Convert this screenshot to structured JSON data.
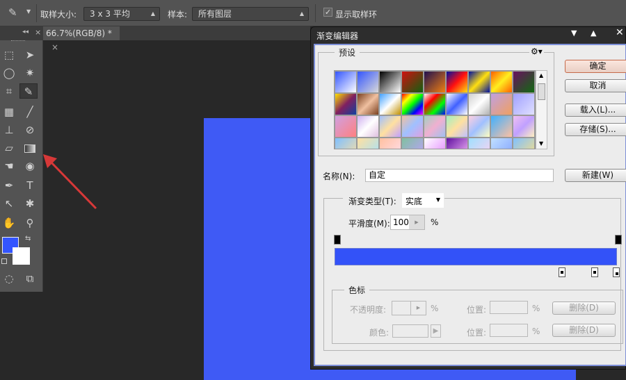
{
  "options_bar": {
    "tool_icon": "eyedropper-icon",
    "sample_size_label": "取样大小:",
    "sample_size_value": "3 x 3 平均",
    "sample_label": "样本:",
    "sample_value": "所有图层",
    "show_ring_label": "显示取样环",
    "show_ring_checked": true
  },
  "panel_collapse": "◂◂",
  "panel_close": "×",
  "document_tab": {
    "title": "66.7%(RGB/8) *",
    "close": "×"
  },
  "tools": {
    "foreground": "#3355ff",
    "background": "#ffffff"
  },
  "canvas_color": "#3f5af5",
  "dialog": {
    "title": "渐变编辑器",
    "title_icons": [
      "collapse-down-icon",
      "collapse-up-icon",
      "close-icon"
    ],
    "presets_label": "预设",
    "buttons": {
      "ok": "确定",
      "cancel": "取消",
      "load": "载入(L)...",
      "save": "存储(S)...",
      "new": "新建(W)"
    },
    "name_label": "名称(N):",
    "name_value": "自定",
    "type_label": "渐变类型(T):",
    "type_value": "实底",
    "smooth_label": "平滑度(M):",
    "smooth_value": "100",
    "percent": "%",
    "gradient_color": "#3352f8",
    "stops_group": "色标",
    "opacity_label": "不透明度:",
    "color_label": "颜色:",
    "location_label": "位置:",
    "delete_label": "删除(D)",
    "presets": [
      [
        "#3355ff",
        "#ffffff"
      ],
      [
        "#3355ff",
        "#d8d8d8"
      ],
      [
        "#000000",
        "#ffffff"
      ],
      [
        "#d01010",
        "#106010"
      ],
      [
        "#201050",
        "#f08010"
      ],
      [
        "#0010a0",
        "#ff1010",
        "#ffe010"
      ],
      [
        "#0010a0",
        "#ffe010",
        "#0010a0"
      ],
      [
        "#ff6000",
        "#ffee20",
        "#ff6000"
      ],
      [
        "#6a1060",
        "#106a10"
      ],
      [
        "#ffe000",
        "#802060",
        "#1040a0"
      ],
      [
        "#7a4020",
        "#f0c0a0",
        "#7a4020"
      ],
      [
        "#40a0ff",
        "#ffffff",
        "#c09000"
      ],
      [
        "#ff0000",
        "#ffff00",
        "#00ff00",
        "#0000ff",
        "#ff00ff"
      ],
      [
        "#ffffff",
        "#ff0000",
        "#00ff00",
        "#0000ff"
      ],
      [
        "#ffffff",
        "#4060ff",
        "#ffffff"
      ],
      [
        "#d0d0d0",
        "#ffffff",
        "#b0b0b0"
      ],
      [
        "#c0a0e0",
        "#f0a060"
      ],
      [
        "#a0a0ff",
        "#e0e0ff"
      ],
      [
        "#d0a0e0",
        "#ff8080"
      ],
      [
        "#d0b0f0",
        "#ffffff",
        "#e0c0e0"
      ],
      [
        "#a0c0ff",
        "#ffe0a0",
        "#c0a0ff"
      ],
      [
        "#f0c0a0",
        "#a0c0ff",
        "#e0a0e0"
      ],
      [
        "#a0d0c0",
        "#f0b0d0",
        "#a0c0f0"
      ],
      [
        "#a0f0c0",
        "#ffe0a0",
        "#c0c0ff"
      ],
      [
        "#ffd0e0",
        "#a0c0ff",
        "#ffffc0"
      ],
      [
        "#40b0ff",
        "#ffc0a0"
      ],
      [
        "#f0c0f0",
        "#c0a0ff",
        "#fff0c0"
      ],
      [
        "#80c0ff",
        "#ffe0a0"
      ],
      [
        "#ffe0a0",
        "#a0e0ff"
      ],
      [
        "#ffc0a0",
        "#ffe0f0"
      ],
      [
        "#80c0a0",
        "#c0a0ff"
      ],
      [
        "#ffffff",
        "#e080ff"
      ],
      [
        "#6010a0",
        "#ffc0ff"
      ],
      [
        "#a0e0ff",
        "#ffd0f0"
      ],
      [
        "#c0e0ff",
        "#80a0ff"
      ],
      [
        "#80c0ff",
        "#ffe080"
      ]
    ]
  }
}
